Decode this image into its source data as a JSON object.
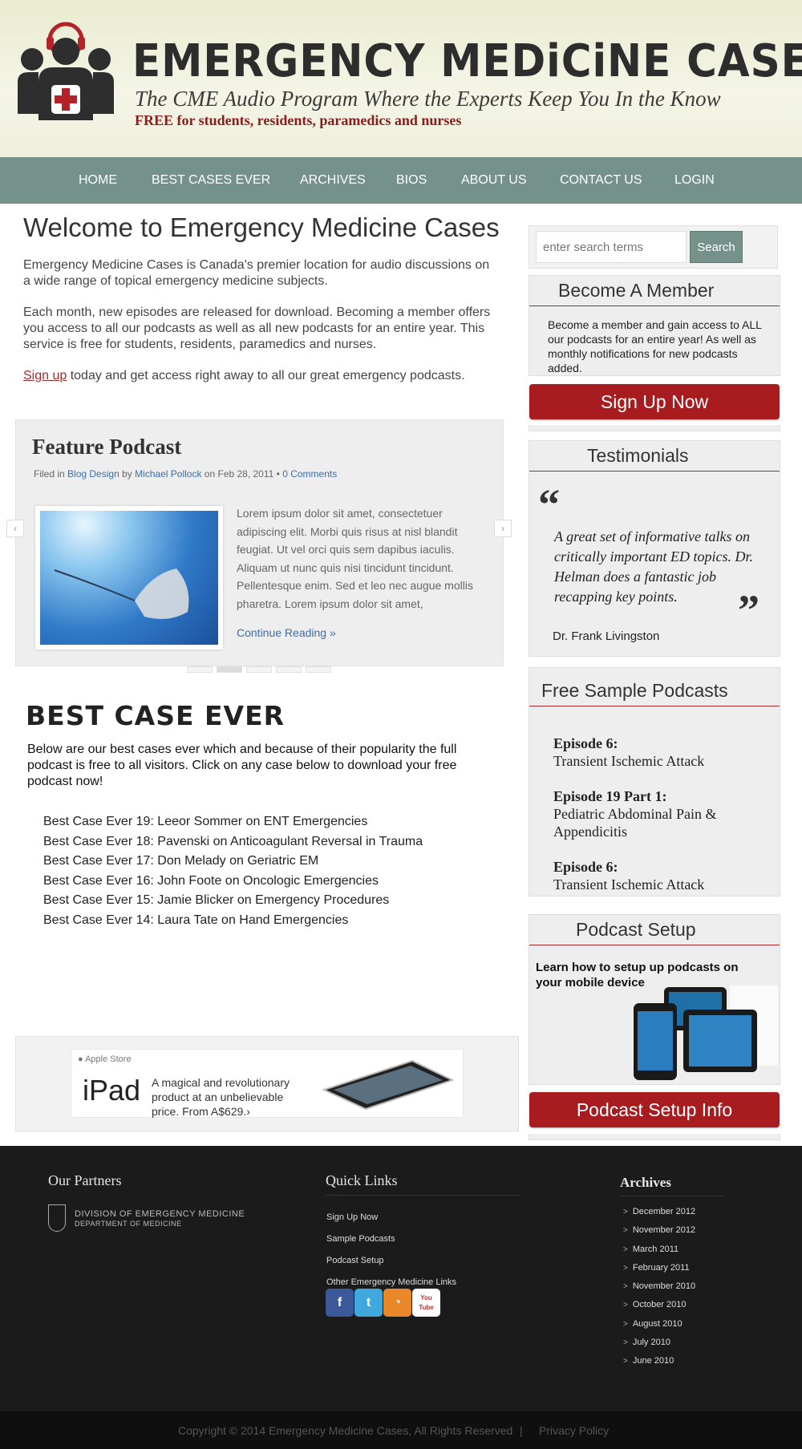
{
  "header": {
    "title": "EMERGENCY MEDiCiNE CASES",
    "tagline": "The CME Audio Program Where the Experts Keep You In the Know",
    "subtagline": "FREE for students, residents, paramedics and nurses"
  },
  "nav": {
    "items": [
      {
        "label": "HOME"
      },
      {
        "label": "BEST CASES EVER"
      },
      {
        "label": "ARCHIVES"
      },
      {
        "label": "BIOS"
      },
      {
        "label": "ABOUT US"
      },
      {
        "label": "CONTACT US"
      },
      {
        "label": "LOGIN"
      }
    ]
  },
  "main": {
    "welcome_title": "Welcome to Emergency Medicine Cases",
    "para1": "Emergency Medicine Cases is Canada's premier location for audio discussions on a wide range of topical emergency medicine subjects.",
    "para2": "Each month, new episodes are released for download. Becoming a member offers you access to all our podcasts as well as all new podcasts for an entire year. This service is free for students, residents, paramedics and nurses.",
    "signup_link": "Sign up",
    "para3_rest": " today and get access right away to all our great emergency podcasts."
  },
  "feature": {
    "title": "Feature Podcast",
    "filed_in": "Filed in ",
    "category": "Blog Design",
    "by": " by ",
    "author": "Michael Pollock",
    "on_date": " on Feb 28, 2011 • ",
    "comments": "0 Comments",
    "excerpt": "Lorem ipsum dolor sit amet, consectetuer adipiscing elit. Morbi quis risus at nisl blandit feugiat. Ut vel orci quis sem dapibus iaculis. Aliquam ut nunc quis nisi tincidunt tincidunt. Pellentesque enim. Sed et leo nec augue mollis pharetra. Lorem ipsum dolor sit amet,",
    "continue": "Continue Reading »",
    "prev_arrow": "‹",
    "next_arrow": "›",
    "slide_count": 5,
    "active_slide": 2
  },
  "best_case": {
    "title": "BEST CASE EVER",
    "intro": "Below are our best cases ever which and because of their popularity the full podcast is free to all visitors.  Click on any case below to download your free podcast now!",
    "items": [
      "Best Case Ever 19: Leeor Sommer on ENT Emergencies",
      "Best Case Ever 18: Pavenski on Anticoagulant Reversal in Trauma",
      "Best Case Ever 17: Don Melady on Geriatric EM",
      "Best Case Ever 16: John Foote on Oncologic Emergencies",
      "Best Case Ever 15: Jamie Blicker on Emergency Procedures",
      "Best Case Ever 14: Laura Tate on Hand Emergencies"
    ]
  },
  "ad": {
    "store": "Apple Store",
    "product": "iPad",
    "copy": "A magical and revolutionary product at an unbelievable price. From A$629.›"
  },
  "sidebar": {
    "search_placeholder": "enter search terms",
    "search_button": "Search",
    "member_title": "Become A Member",
    "member_text": "Become a member and gain access to ALL our podcasts for an entire year! As well as monthly notifications for new podcasts added.",
    "signup_button": "Sign Up Now",
    "testimonials_title": "Testimonials",
    "quote_open": "“",
    "quote_close": "”",
    "quote": "A great set of informative talks on critically important ED topics. Dr. Helman does a fantastic job recapping key points.",
    "quote_author": "Dr. Frank Livingston",
    "samples_title": "Free Sample Podcasts",
    "samples": [
      {
        "episode": "Episode 6:",
        "title": "Transient Ischemic Attack"
      },
      {
        "episode": "Episode 19 Part 1:",
        "title": "Pediatric Abdominal Pain & Appendicitis"
      },
      {
        "episode": "Episode 6:",
        "title": "Transient Ischemic Attack"
      }
    ],
    "setup_title": "Podcast Setup",
    "setup_text": "Learn how to setup up podcasts on your mobile device",
    "setup_button": "Podcast Setup Info"
  },
  "footer": {
    "partners_title": "Our Partners",
    "partner_line1": "DIVISION OF EMERGENCY MEDICINE",
    "partner_line2": "DEPARTMENT OF MEDICINE",
    "quicklinks_title": "Quick Links",
    "quicklinks": [
      "Sign Up Now",
      "Sample Podcasts",
      "Podcast Setup",
      "Other Emergency Medicine Links"
    ],
    "social": [
      {
        "name": "facebook-icon",
        "glyph": "f",
        "color": "#3b5998"
      },
      {
        "name": "twitter-icon",
        "glyph": "t",
        "color": "#3fa9dd"
      },
      {
        "name": "rss-icon",
        "glyph": "◔",
        "color": "#e8882b"
      },
      {
        "name": "youtube-icon",
        "glyph": "You Tube",
        "color": "#ffffff"
      }
    ],
    "archives_title": "Archives",
    "archives": [
      "December 2012",
      "November 2012",
      "March 2011",
      "February 2011",
      "November 2010",
      "October 2010",
      "August 2010",
      "July 2010",
      "June 2010"
    ],
    "copyright": "Copyright © 2014 Emergency Medicine Cases, All Rights Reserved",
    "separator": "|",
    "privacy": "Privacy Policy"
  },
  "colors": {
    "nav": "#75928a",
    "accent_red": "#a81c1f",
    "link_blue": "#3c6fa8",
    "footer": "#1b1b1b"
  }
}
